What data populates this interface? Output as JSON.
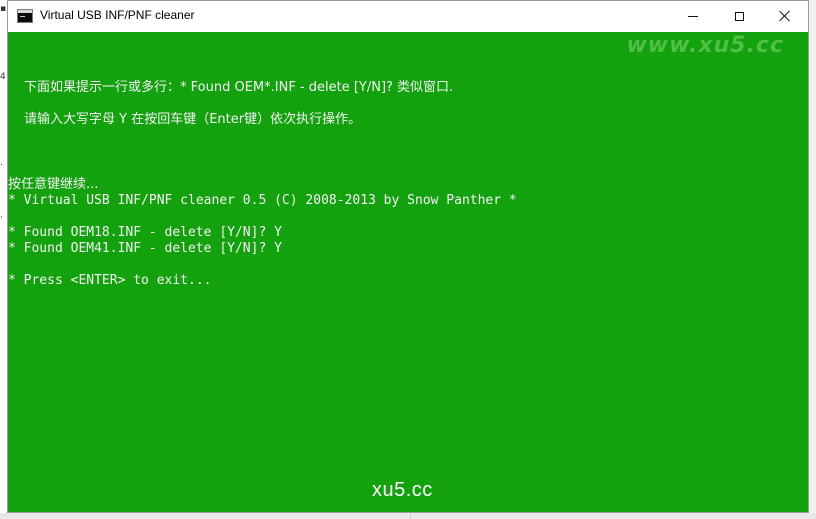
{
  "window": {
    "title": "Virtual USB INF/PNF cleaner",
    "colors": {
      "console_bg": "#13a10e",
      "console_fg": "#f2f2f2",
      "titlebar_bg": "#ffffff"
    }
  },
  "controls": {
    "minimize_icon": "minimize-icon",
    "maximize_icon": "maximize-icon",
    "close_icon": "close-icon"
  },
  "watermark": {
    "top": "www.xu5.cc",
    "bottom": "xu5.cc"
  },
  "console": {
    "lines": [
      "下面如果提示一行或多行：* Found OEM*.INF - delete [Y/N]? 类似窗口.",
      "请输入大写字母 Y 在按回车键（Enter键）依次执行操作。",
      "按任意键继续...",
      "* Virtual USB INF/PNF cleaner 0.5 (C) 2008-2013 by Snow Panther *",
      "* Found OEM18.INF - delete [Y/N]? Y",
      "* Found OEM41.INF - delete [Y/N]? Y",
      "* Press <ENTER> to exit..."
    ]
  }
}
